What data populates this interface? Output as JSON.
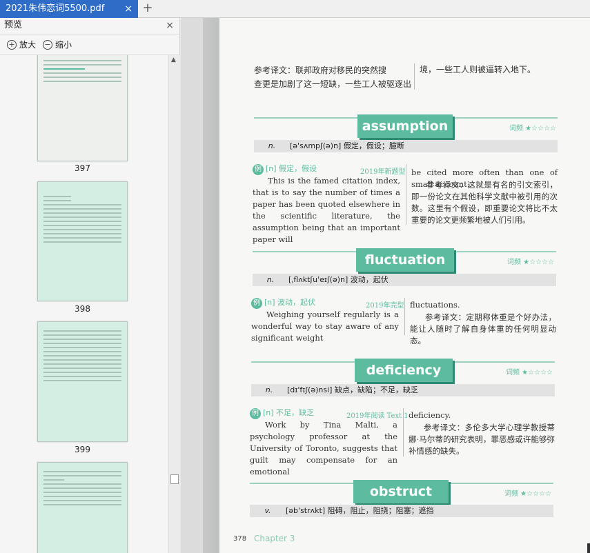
{
  "tab": {
    "title": "2021朱伟恋词5500.pdf",
    "close": "×",
    "add": "+"
  },
  "sidebar": {
    "title": "预览",
    "close": "×",
    "zoom_in": "放大",
    "zoom_out": "缩小",
    "thumbnails": [
      {
        "label": "397"
      },
      {
        "label": "398"
      },
      {
        "label": "399"
      },
      {
        "label": ""
      }
    ]
  },
  "page": {
    "top_translation_left": [
      "参考译文：联邦政府对移民的突然搜",
      "查更是加剧了这一短缺，一些工人被驱逐出"
    ],
    "top_translation_right": "境，一些工人则被逼转入地下。",
    "entries": [
      {
        "word": "assumption",
        "freq": "词频 ★☆☆☆☆",
        "pos": "n.",
        "def": "[ə'sʌmpʃ(ə)n] 假定，假设；臆断",
        "ex_label": "[n] 假定，假设",
        "ex_source": "2019年新题型",
        "ex_left": "This is the famed citation index, that is to say the number of times a paper has been quoted elsewhere in the scientific literature, the assumption being that an important paper will",
        "ex_right_en": "be cited more often than one of small account.",
        "ex_right_cn": "参考译文：这就是有名的引文索引，即一份论文在其他科学文献中被引用的次数。这里有个假设，即重要论文将比不太重要的论文更频繁地被人们引用。"
      },
      {
        "word": "fluctuation",
        "freq": "词频 ★☆☆☆☆",
        "pos": "n.",
        "def": "[ˌflʌktʃu'eɪʃ(ə)n] 波动，起伏",
        "ex_label": "[n] 波动，起伏",
        "ex_source": "2019年完型",
        "ex_left": "Weighing yourself regularly is a wonderful way to stay aware of any significant weight",
        "ex_right_en": "fluctuations.",
        "ex_right_cn": "参考译文：定期称体重是个好办法，能让人随时了解自身体重的任何明显动态。"
      },
      {
        "word": "deficiency",
        "freq": "词频 ★☆☆☆☆",
        "pos": "n.",
        "def": "[dɪ'fɪʃ(ə)nsi] 缺点，缺陷；不足，缺乏",
        "ex_label": "[n] 不足，缺乏",
        "ex_source": "2019年阅读 Text 1",
        "ex_left": "Work by Tina Malti, a psychology professor at the University of Toronto, suggests that guilt may compensate for an emotional",
        "ex_right_en": "deficiency.",
        "ex_right_cn": "参考译文：多伦多大学心理学教授蒂娜·马尔蒂的研究表明，罪恶感或许能够弥补情感的缺失。"
      },
      {
        "word": "obstruct",
        "freq": "词频 ★☆☆☆☆",
        "pos": "v.",
        "def": "[əb'strʌkt] 阻碍，阻止，阻挠；阻塞；遮挡"
      }
    ],
    "footer_num": "378",
    "footer_chapter": "Chapter 3"
  }
}
